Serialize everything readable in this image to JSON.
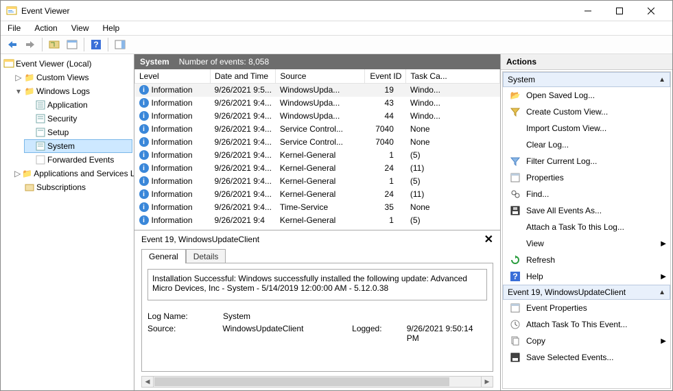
{
  "window": {
    "title": "Event Viewer"
  },
  "menu": {
    "file": "File",
    "action": "Action",
    "view": "View",
    "help": "Help"
  },
  "tree": {
    "root": "Event Viewer (Local)",
    "custom_views": "Custom Views",
    "windows_logs": "Windows Logs",
    "application": "Application",
    "security": "Security",
    "setup": "Setup",
    "system": "System",
    "forwarded": "Forwarded Events",
    "apps_services": "Applications and Services Lo",
    "subscriptions": "Subscriptions"
  },
  "log_header": {
    "name": "System",
    "count_label": "Number of events: 8,058"
  },
  "columns": {
    "level": "Level",
    "datetime": "Date and Time",
    "source": "Source",
    "eventid": "Event ID",
    "taskcat": "Task Ca..."
  },
  "events": [
    {
      "level": "Information",
      "dt": "9/26/2021 9:5...",
      "src": "WindowsUpda...",
      "id": "19",
      "task": "Windo...",
      "sel": true
    },
    {
      "level": "Information",
      "dt": "9/26/2021 9:4...",
      "src": "WindowsUpda...",
      "id": "43",
      "task": "Windo..."
    },
    {
      "level": "Information",
      "dt": "9/26/2021 9:4...",
      "src": "WindowsUpda...",
      "id": "44",
      "task": "Windo..."
    },
    {
      "level": "Information",
      "dt": "9/26/2021 9:4...",
      "src": "Service Control...",
      "id": "7040",
      "task": "None"
    },
    {
      "level": "Information",
      "dt": "9/26/2021 9:4...",
      "src": "Service Control...",
      "id": "7040",
      "task": "None"
    },
    {
      "level": "Information",
      "dt": "9/26/2021 9:4...",
      "src": "Kernel-General",
      "id": "1",
      "task": "(5)"
    },
    {
      "level": "Information",
      "dt": "9/26/2021 9:4...",
      "src": "Kernel-General",
      "id": "24",
      "task": "(11)"
    },
    {
      "level": "Information",
      "dt": "9/26/2021 9:4...",
      "src": "Kernel-General",
      "id": "1",
      "task": "(5)"
    },
    {
      "level": "Information",
      "dt": "9/26/2021 9:4...",
      "src": "Kernel-General",
      "id": "24",
      "task": "(11)"
    },
    {
      "level": "Information",
      "dt": "9/26/2021 9:4...",
      "src": "Time-Service",
      "id": "35",
      "task": "None"
    },
    {
      "level": "Information",
      "dt": "9/26/2021 9:4",
      "src": "Kernel-General",
      "id": "1",
      "task": "(5)"
    }
  ],
  "detail": {
    "title": "Event 19, WindowsUpdateClient",
    "tab_general": "General",
    "tab_details": "Details",
    "message": "Installation Successful: Windows successfully installed the following update: Advanced Micro Devices, Inc - System - 5/14/2019 12:00:00 AM - 5.12.0.38",
    "logname_k": "Log Name:",
    "logname_v": "System",
    "source_k": "Source:",
    "source_v": "WindowsUpdateClient",
    "logged_k": "Logged:",
    "logged_v": "9/26/2021 9:50:14 PM"
  },
  "actions": {
    "header": "Actions",
    "group1": "System",
    "open_saved": "Open Saved Log...",
    "create_custom": "Create Custom View...",
    "import_custom": "Import Custom View...",
    "clear_log": "Clear Log...",
    "filter_log": "Filter Current Log...",
    "properties": "Properties",
    "find": "Find...",
    "save_all": "Save All Events As...",
    "attach_task": "Attach a Task To this Log...",
    "view": "View",
    "refresh": "Refresh",
    "help": "Help",
    "group2": "Event 19, WindowsUpdateClient",
    "event_props": "Event Properties",
    "attach_event": "Attach Task To This Event...",
    "copy": "Copy",
    "save_selected": "Save Selected Events..."
  }
}
